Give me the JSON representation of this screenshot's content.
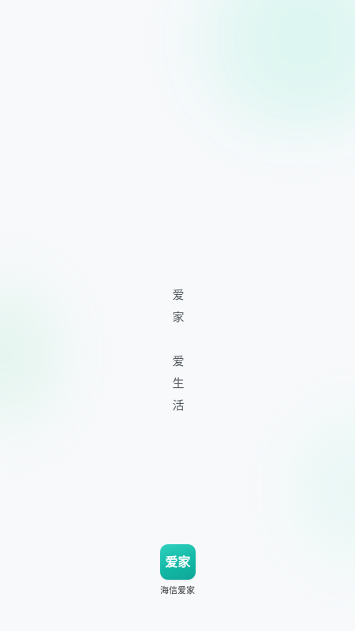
{
  "splash": {
    "slogan_line1": [
      "爱",
      "家"
    ],
    "slogan_line2": [
      "爱",
      "生",
      "活"
    ],
    "app_icon_text": "爱家",
    "app_name": "海信爱家",
    "colors": {
      "background": "#f7f9fb",
      "accent": "#13b8a6",
      "slogan_text": "#555a5f",
      "app_name_text": "#333333"
    }
  }
}
